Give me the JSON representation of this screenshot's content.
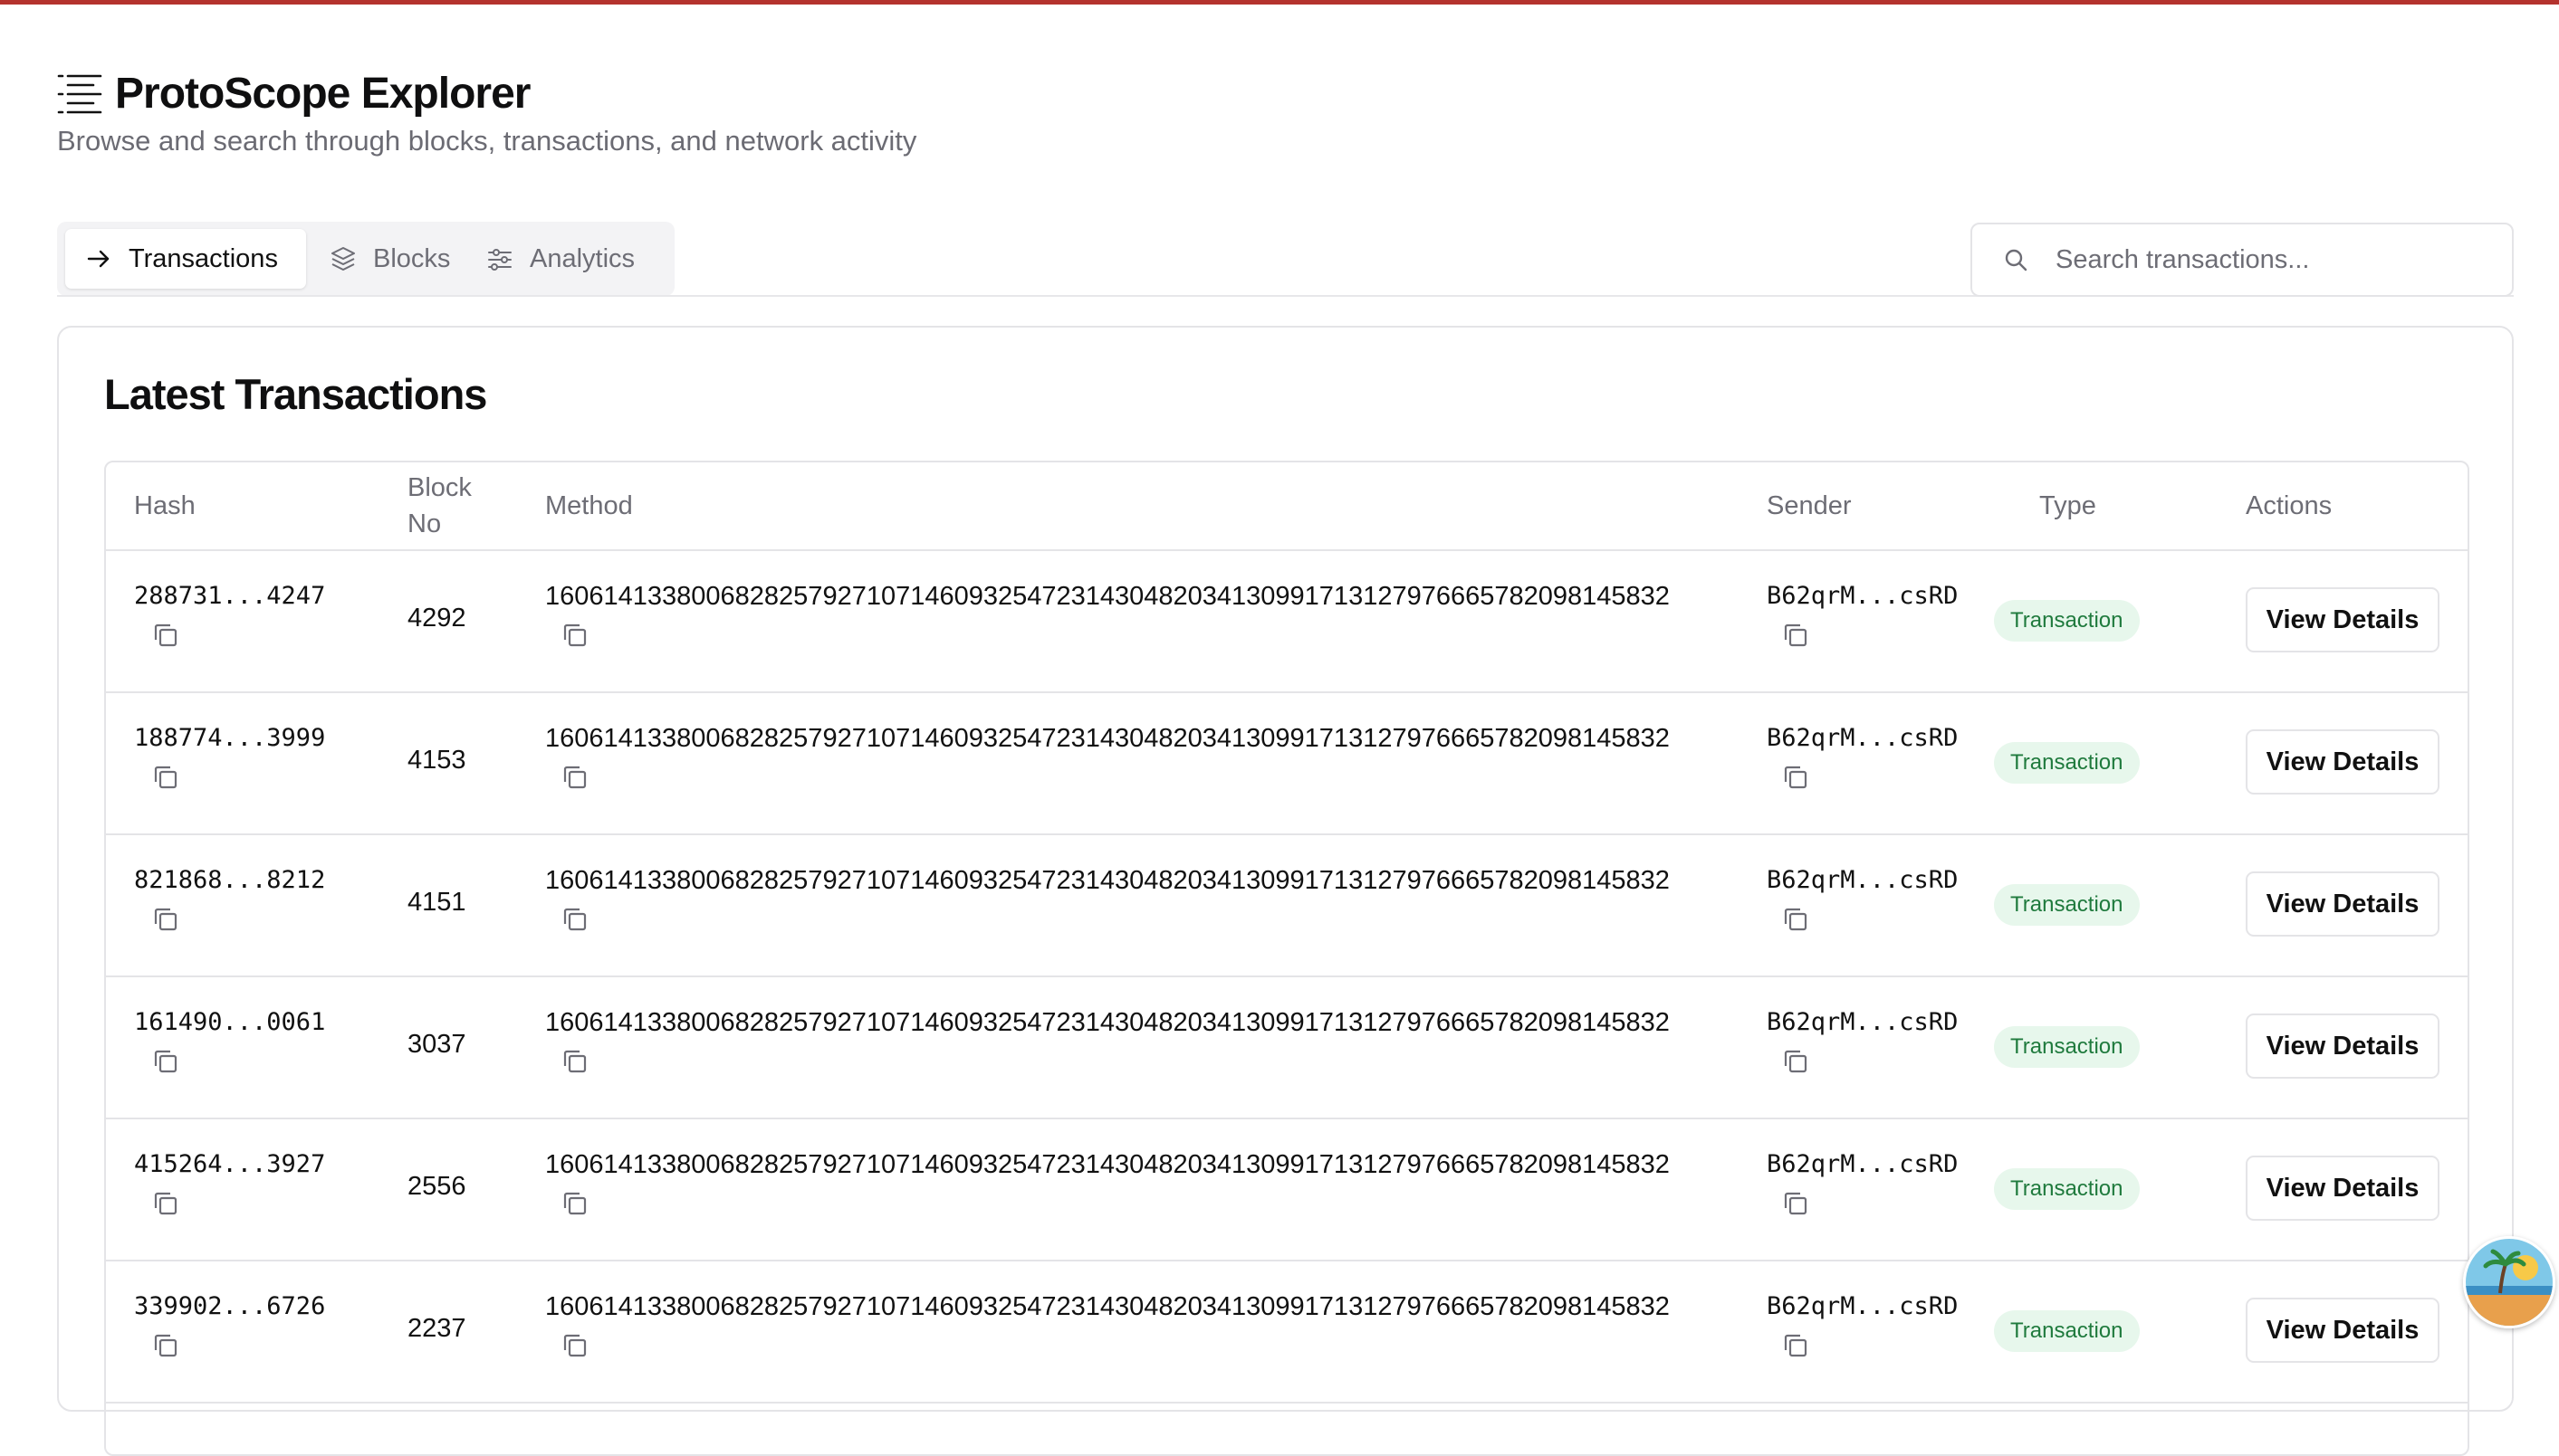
{
  "app": {
    "title": "ProtoScope Explorer",
    "subtitle": "Browse and search through blocks, transactions, and network activity"
  },
  "tabs": [
    {
      "label": "Transactions",
      "icon": "arrow-right-icon",
      "active": true
    },
    {
      "label": "Blocks",
      "icon": "layers-icon",
      "active": false
    },
    {
      "label": "Analytics",
      "icon": "sliders-icon",
      "active": false
    }
  ],
  "search": {
    "placeholder": "Search transactions..."
  },
  "card": {
    "title": "Latest Transactions"
  },
  "table": {
    "headers": {
      "hash": "Hash",
      "block_line1": "Block",
      "block_line2": "No",
      "method": "Method",
      "sender": "Sender",
      "type": "Type",
      "actions": "Actions"
    },
    "rows": [
      {
        "hash": "288731...4247",
        "block": "4292",
        "method": "16061413380068282579271071460932547231430482034130991713127976665782098145832",
        "sender": "B62qrM...csRD",
        "type": "Transaction",
        "action": "View Details"
      },
      {
        "hash": "188774...3999",
        "block": "4153",
        "method": "16061413380068282579271071460932547231430482034130991713127976665782098145832",
        "sender": "B62qrM...csRD",
        "type": "Transaction",
        "action": "View Details"
      },
      {
        "hash": "821868...8212",
        "block": "4151",
        "method": "16061413380068282579271071460932547231430482034130991713127976665782098145832",
        "sender": "B62qrM...csRD",
        "type": "Transaction",
        "action": "View Details"
      },
      {
        "hash": "161490...0061",
        "block": "3037",
        "method": "16061413380068282579271071460932547231430482034130991713127976665782098145832",
        "sender": "B62qrM...csRD",
        "type": "Transaction",
        "action": "View Details"
      },
      {
        "hash": "415264...3927",
        "block": "2556",
        "method": "16061413380068282579271071460932547231430482034130991713127976665782098145832",
        "sender": "B62qrM...csRD",
        "type": "Transaction",
        "action": "View Details"
      },
      {
        "hash": "339902...6726",
        "block": "2237",
        "method": "16061413380068282579271071460932547231430482034130991713127976665782098145832",
        "sender": "B62qrM...csRD",
        "type": "Transaction",
        "action": "View Details"
      }
    ]
  },
  "colors": {
    "accent_bar": "#b4332e",
    "badge_bg": "#e7f7ec",
    "badge_text": "#1f7a3d",
    "muted_text": "#6d6d75",
    "border": "#e4e4e7"
  },
  "icons": {
    "logo": "list-icon",
    "search": "search-icon",
    "copy": "copy-icon",
    "avatar": "beach-avatar-icon"
  }
}
